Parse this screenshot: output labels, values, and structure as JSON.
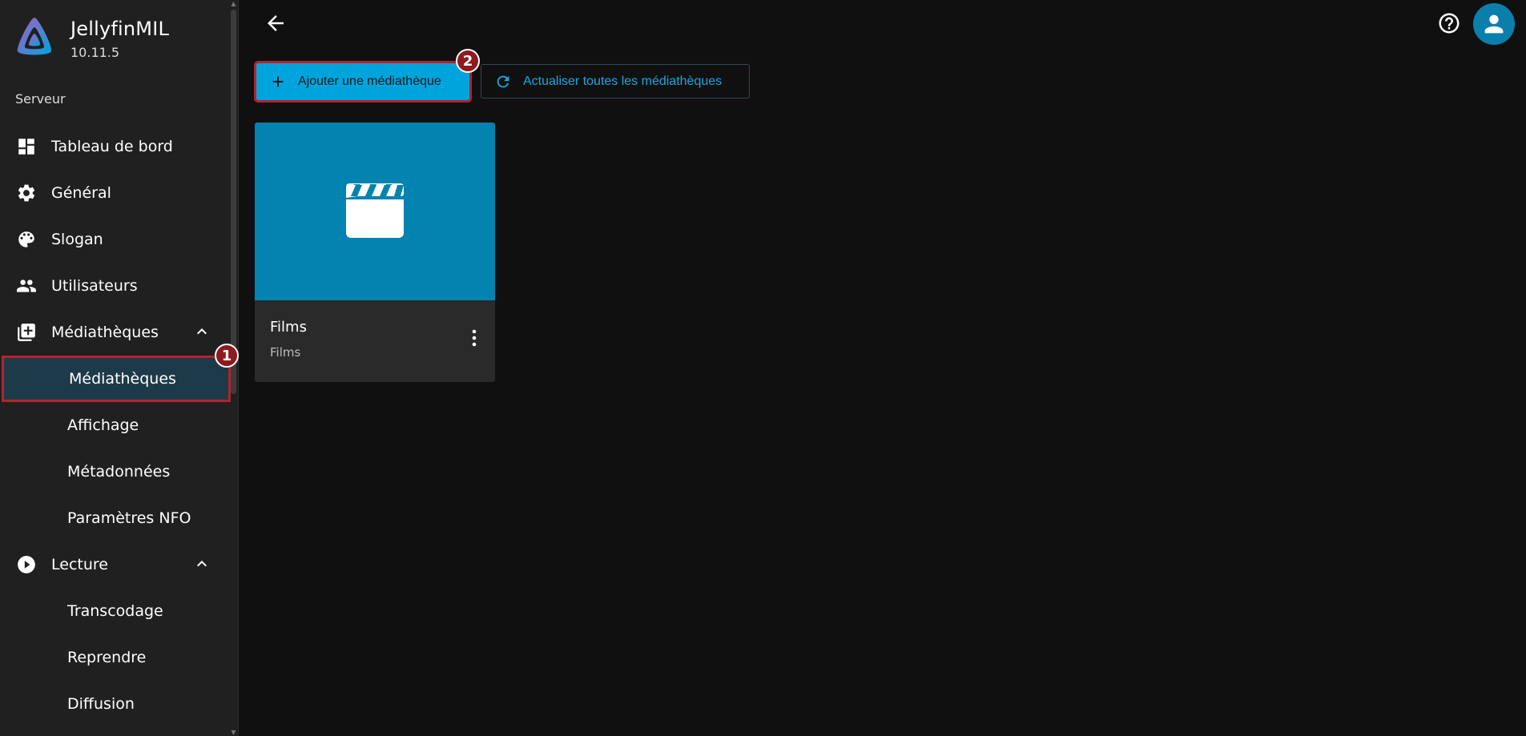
{
  "brand": {
    "name": "JellyfinMIL",
    "version": "10.11.5"
  },
  "sidebar": {
    "section_label": "Serveur",
    "items": [
      {
        "label": "Tableau de bord",
        "icon": "dashboard-icon"
      },
      {
        "label": "Général",
        "icon": "gear-icon"
      },
      {
        "label": "Slogan",
        "icon": "palette-icon"
      },
      {
        "label": "Utilisateurs",
        "icon": "users-icon"
      },
      {
        "label": "Médiathèques",
        "icon": "library-add-icon",
        "expanded": true
      },
      {
        "label": "Médiathèques",
        "sub": true,
        "active": true
      },
      {
        "label": "Affichage",
        "sub": true
      },
      {
        "label": "Métadonnées",
        "sub": true
      },
      {
        "label": "Paramètres NFO",
        "sub": true
      },
      {
        "label": "Lecture",
        "icon": "play-circle-icon",
        "expanded": true
      },
      {
        "label": "Transcodage",
        "sub": true
      },
      {
        "label": "Reprendre",
        "sub": true
      },
      {
        "label": "Diffusion",
        "sub": true
      }
    ]
  },
  "annotations": {
    "badge_1": "1",
    "badge_2": "2"
  },
  "toolbar": {
    "add_label": "Ajouter une médiathèque",
    "refresh_label": "Actualiser toutes les médiathèques"
  },
  "libraries": [
    {
      "title": "Films",
      "subtitle": "Films",
      "icon": "clapperboard-icon"
    }
  ],
  "colors": {
    "accent": "#00a4dc",
    "card_image": "#0283b0",
    "highlight": "#b3232b",
    "sidebar_bg": "#202020",
    "page_bg": "#101010"
  }
}
